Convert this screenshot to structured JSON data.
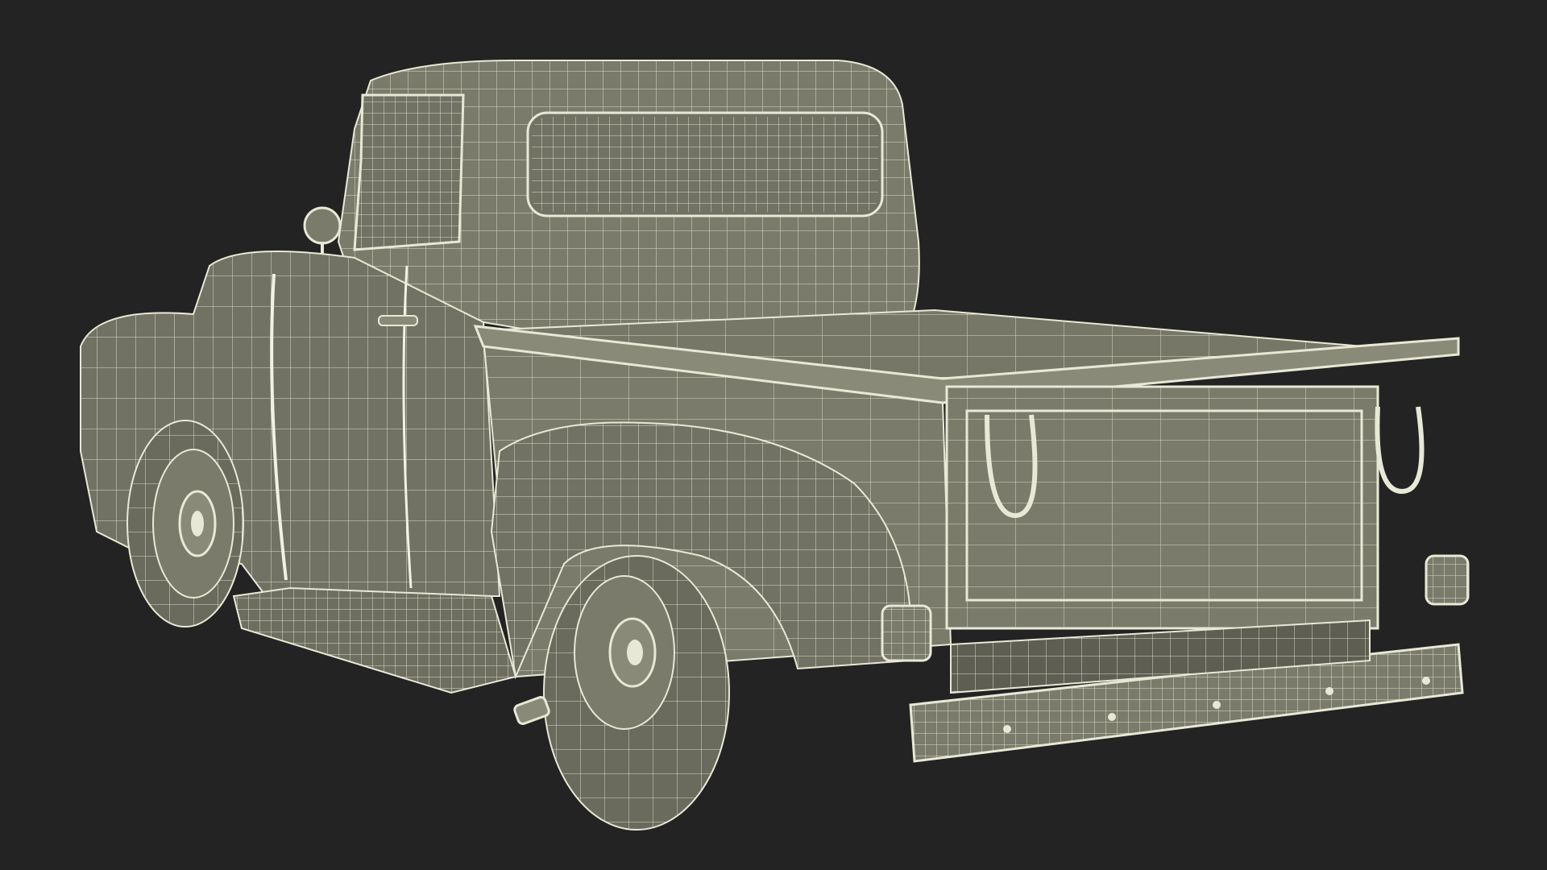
{
  "scene": {
    "subject": "pickup-truck-wireframe",
    "colors": {
      "background": "#232323",
      "surface": "#7b7b6b",
      "surface_dark": "#66665a",
      "surface_light": "#8a8a79",
      "wire": "#e8e8d6"
    }
  }
}
